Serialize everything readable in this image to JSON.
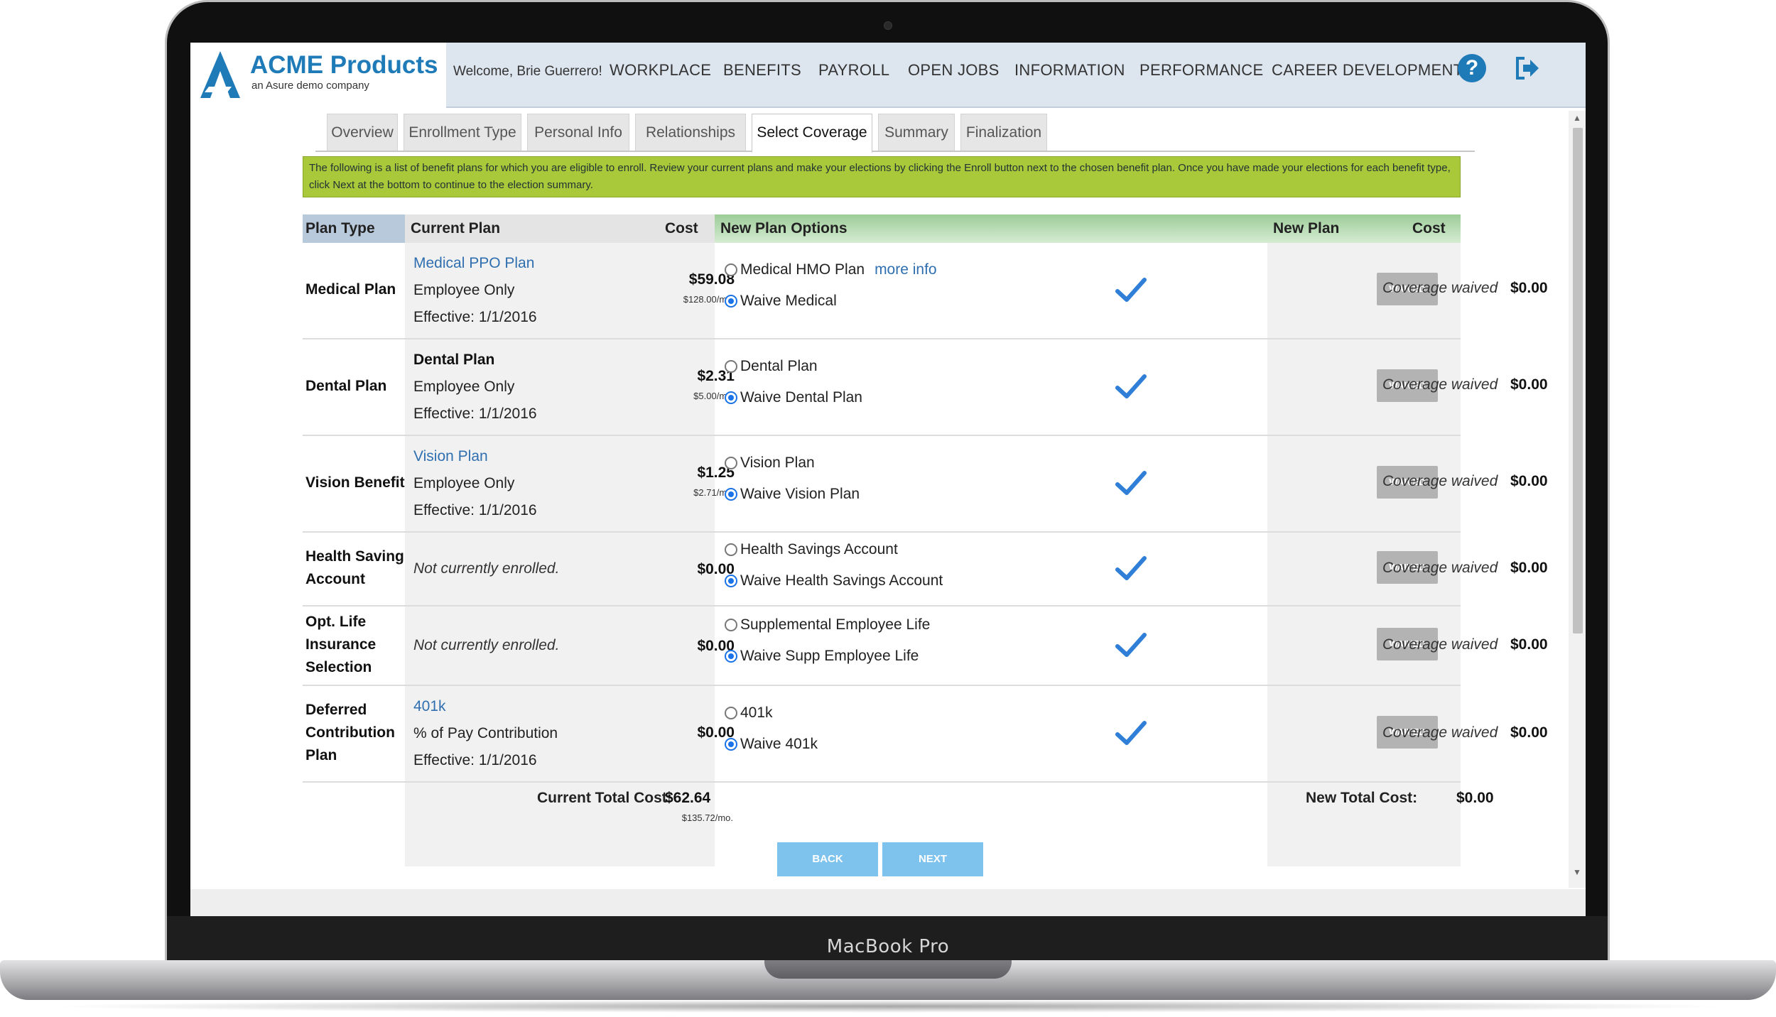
{
  "device": {
    "label": "MacBook Pro"
  },
  "app": {
    "logo_name": "ACME Products",
    "logo_sub": "an Asure demo company",
    "welcome": "Welcome, Brie Guerrero!",
    "accent": "#1f7ab8"
  },
  "nav": [
    "WORKPLACE",
    "BENEFITS",
    "PAYROLL",
    "OPEN JOBS",
    "INFORMATION",
    "PERFORMANCE",
    "CAREER DEVELOPMENT"
  ],
  "tabs": [
    "Overview",
    "Enrollment Type",
    "Personal Info",
    "Relationships",
    "Select Coverage",
    "Summary",
    "Finalization"
  ],
  "active_tab": "Select Coverage",
  "notice": "The following is a list of benefit plans for which you are eligible to enroll. Review your current plans and make your elections by clicking the Enroll button next to the chosen benefit plan. Once you have made your elections for each benefit type, click Next at the bottom to continue to the election summary.",
  "headers": {
    "plan_type": "Plan Type",
    "current_plan": "Current Plan",
    "cost": "Cost",
    "new_plan_options": "New Plan Options",
    "new_plan": "New Plan",
    "new_cost": "Cost"
  },
  "rows": [
    {
      "plan_type": "Medical Plan",
      "current": {
        "name": "Medical PPO Plan",
        "coverage": "Employee Only",
        "effective": "Effective: 1/1/2016"
      },
      "cost": "$59.08",
      "cost_sub": "$128.00/mo.",
      "option_1": "Medical HMO Plan",
      "more_info": "more info",
      "option_2": "Waive Medical",
      "waived": "WAIVED",
      "new_plan": "Coverage waived",
      "new_cost": "$0.00"
    },
    {
      "plan_type": "Dental Plan",
      "current": {
        "name": "Dental Plan",
        "coverage": "Employee Only",
        "effective": "Effective: 1/1/2016"
      },
      "cost": "$2.31",
      "cost_sub": "$5.00/mo.",
      "option_1": "Dental Plan",
      "option_2": "Waive Dental Plan",
      "waived": "WAIVED",
      "new_plan": "Coverage waived",
      "new_cost": "$0.00"
    },
    {
      "plan_type": "Vision Benefit",
      "current": {
        "name": "Vision Plan",
        "coverage": "Employee Only",
        "effective": "Effective: 1/1/2016"
      },
      "cost": "$1.25",
      "cost_sub": "$2.71/mo.",
      "option_1": "Vision Plan",
      "option_2": "Waive Vision Plan",
      "waived": "WAIVED",
      "new_plan": "Coverage waived",
      "new_cost": "$0.00"
    },
    {
      "plan_type_1": "Health Saving",
      "plan_type_2": "Account",
      "not_enrolled": "Not currently enrolled.",
      "cost": "$0.00",
      "option_1": "Health Savings Account",
      "option_2": "Waive Health Savings Account",
      "waived": "WAIVED",
      "new_plan": "Coverage waived",
      "new_cost": "$0.00"
    },
    {
      "plan_type_1": "Opt. Life",
      "plan_type_2": "Insurance",
      "plan_type_3": "Selection",
      "not_enrolled": "Not currently enrolled.",
      "cost": "$0.00",
      "option_1": "Supplemental Employee Life",
      "option_2": "Waive Supp Employee Life",
      "waived": "WAIVED",
      "new_plan": "Coverage waived",
      "new_cost": "$0.00"
    },
    {
      "plan_type_1": "Deferred",
      "plan_type_2": "Contribution",
      "plan_type_3": "Plan",
      "current": {
        "name": "401k",
        "coverage": "% of Pay Contribution",
        "effective": "Effective: 1/1/2016"
      },
      "cost": "$0.00",
      "option_1": "401k",
      "option_2": "Waive 401k",
      "waived": "WAIVED",
      "new_plan": "Coverage waived",
      "new_cost": "$0.00"
    }
  ],
  "totals": {
    "current_label": "Current Total Cost:",
    "current_value": "$62.64",
    "current_sub": "$135.72/mo.",
    "new_label": "New Total Cost:",
    "new_value": "$0.00"
  },
  "buttons": {
    "back": "BACK",
    "next": "NEXT"
  },
  "colors": {
    "notice_bg": "#a9c93a",
    "plan_type_header": "#b9c9dc",
    "options_header": "#8cc08a",
    "button_blue": "#7ec3ee",
    "waived_gray": "#b3b3b3"
  }
}
